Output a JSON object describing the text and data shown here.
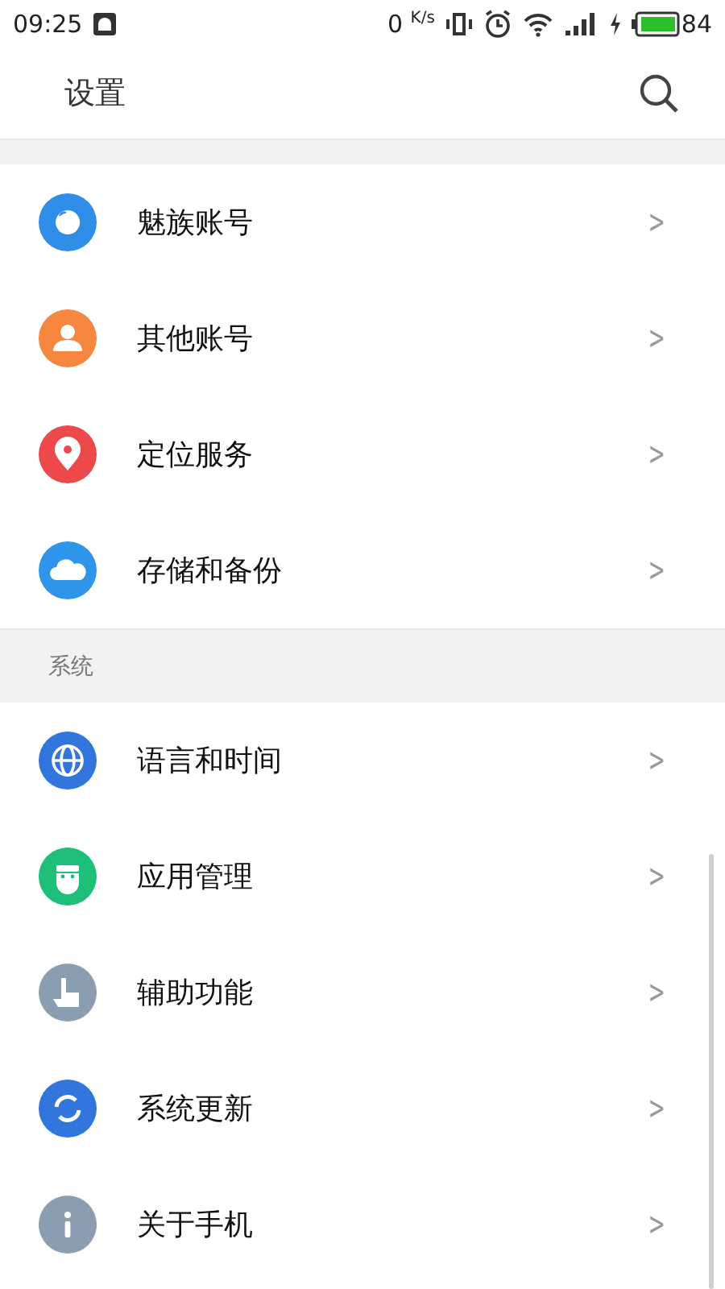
{
  "status_bar": {
    "time": "09:25",
    "speed": "0",
    "speed_unit": "K/s",
    "battery": "84"
  },
  "title_bar": {
    "title": "设置"
  },
  "sections": [
    {
      "items": [
        {
          "label": "魅族账号",
          "color": "#2e8ee8",
          "chevron": ">"
        },
        {
          "label": "其他账号",
          "color": "#f5873f",
          "chevron": ">"
        },
        {
          "label": "定位服务",
          "color": "#ec4a4a",
          "chevron": ">"
        },
        {
          "label": "存储和备份",
          "color": "#2f95ea",
          "chevron": ">"
        }
      ]
    },
    {
      "header": "系统",
      "items": [
        {
          "label": "语言和时间",
          "color": "#3275dc",
          "chevron": ">"
        },
        {
          "label": "应用管理",
          "color": "#1dbf79",
          "chevron": ">"
        },
        {
          "label": "辅助功能",
          "color": "#8a9db1",
          "chevron": ">"
        },
        {
          "label": "系统更新",
          "color": "#3275dc",
          "chevron": ">"
        },
        {
          "label": "关于手机",
          "color": "#8a9db1",
          "chevron": ">"
        }
      ]
    }
  ]
}
